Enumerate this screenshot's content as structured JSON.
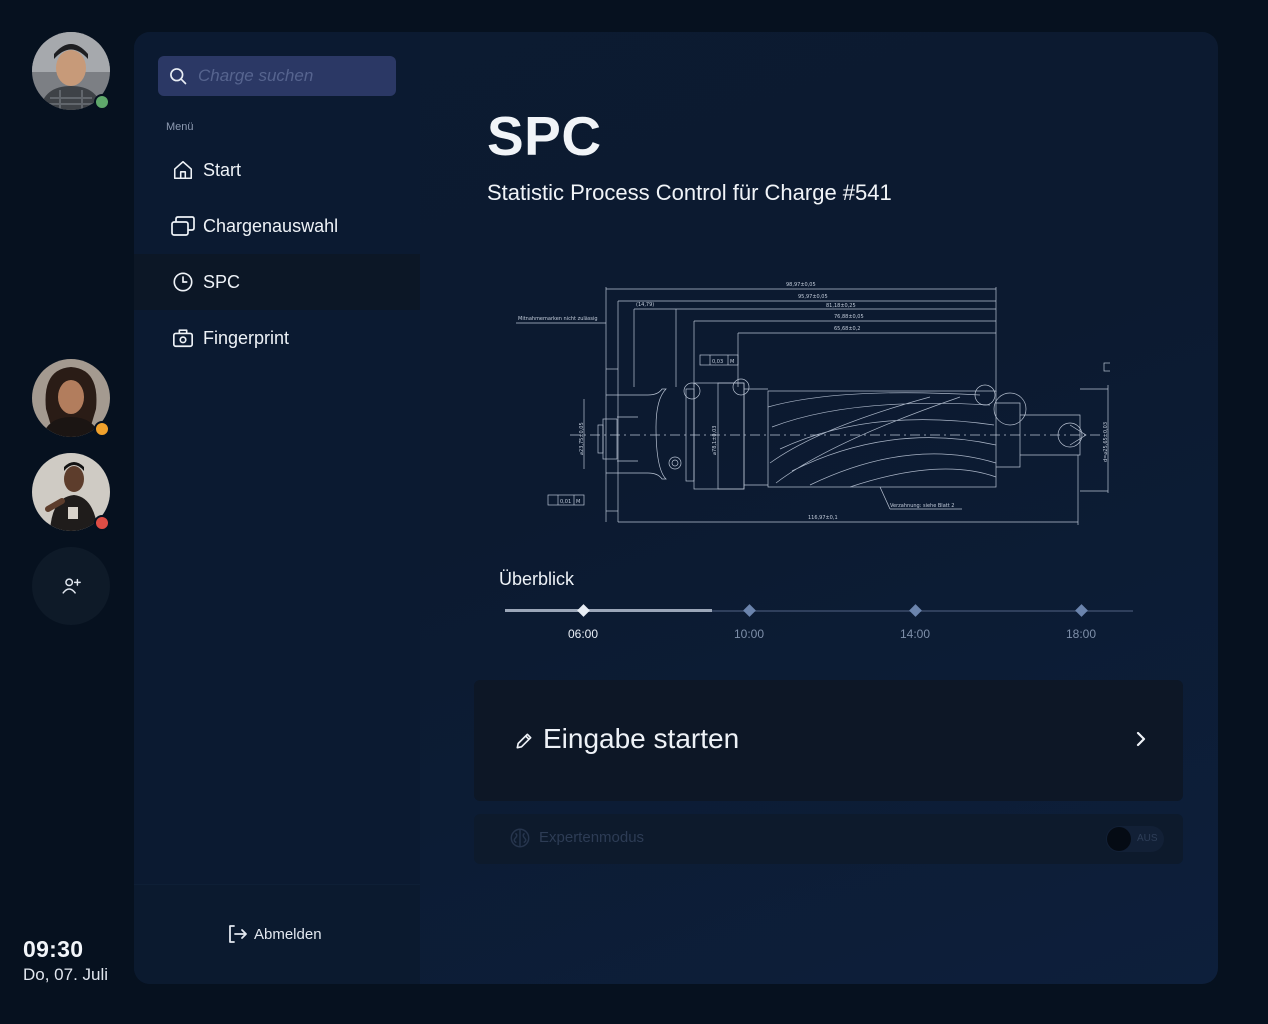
{
  "search": {
    "placeholder": "Charge suchen",
    "icon": "search-icon"
  },
  "sidebar": {
    "menu_label": "Menü",
    "items": [
      {
        "label": "Start",
        "icon": "home-icon"
      },
      {
        "label": "Chargenauswahl",
        "icon": "stack-icon"
      },
      {
        "label": "SPC",
        "icon": "clock-icon",
        "active": true
      },
      {
        "label": "Fingerprint",
        "icon": "camera-icon"
      }
    ],
    "logout_label": "Abmelden"
  },
  "users": [
    {
      "status": "online",
      "status_color": "#5fa86b"
    },
    {
      "status": "away",
      "status_color": "#f0a12c"
    },
    {
      "status": "busy",
      "status_color": "#de4d45"
    }
  ],
  "clock": {
    "time": "09:30",
    "date": "Do, 07. Juli"
  },
  "page": {
    "title": "SPC",
    "subtitle": "Statistic Process Control für Charge #541"
  },
  "drawing": {
    "dimensions": {
      "d1": "98,97±0,05",
      "d2": "95,97±0,05",
      "d3": "81,18±0,25",
      "d4": "76,88±0,05",
      "d5": "65,68±0,2",
      "d6": "(14,79)",
      "d7": "116,97±0,1",
      "left_dia": "⌀23,75±0,05",
      "mid_dia": "⌀78,1±0,03",
      "right_dia": "d=⌀25,65±0,03"
    },
    "notes": {
      "top_left": "Mitnahmemarken nicht zulässig",
      "bottom": "Verzahnung: siehe Blatt 2"
    },
    "tolerances": {
      "tol_top": "0,03",
      "tol_bottom": "0,01",
      "tol_m": "M"
    }
  },
  "overview": {
    "label": "Überblick",
    "progress": 0.33,
    "points": [
      {
        "label": "06:00",
        "current": true
      },
      {
        "label": "10:00",
        "current": false
      },
      {
        "label": "14:00",
        "current": false
      },
      {
        "label": "18:00",
        "current": false
      }
    ]
  },
  "actions": {
    "start_label": "Eingabe starten",
    "expert_label": "Expertenmodus",
    "expert_toggle": "AUS"
  }
}
